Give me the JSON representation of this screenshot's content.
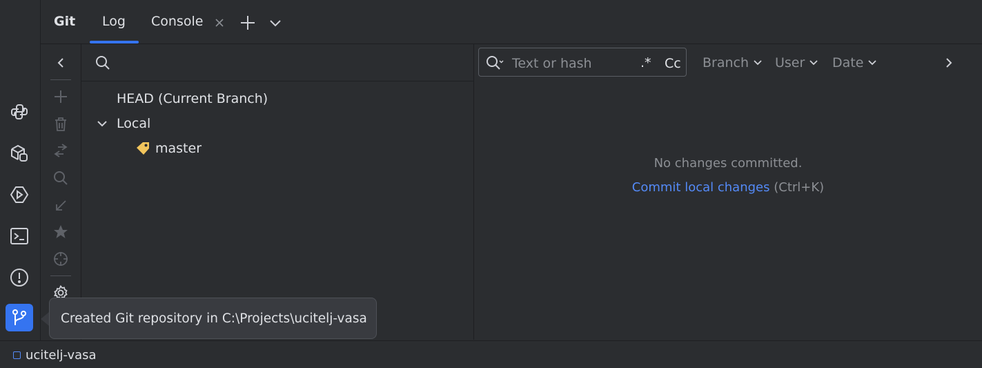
{
  "header": {
    "title": "Git",
    "tabs": [
      {
        "label": "Log",
        "active": true
      },
      {
        "label": "Console",
        "closable": true
      }
    ],
    "add_tab_icon": "plus-icon",
    "more_tabs_icon": "chevron-down-icon"
  },
  "activity_bar": {
    "icons": [
      "python-icon",
      "python-packages-icon",
      "services-icon",
      "terminal-icon",
      "problems-icon",
      "git-branch-icon"
    ],
    "active": "git-branch-icon"
  },
  "branch_toolbar": {
    "icons": [
      "collapse-left-icon",
      "new-branch-icon",
      "delete-icon",
      "compare-icon",
      "search-icon",
      "checkout-icon",
      "favorite-icon",
      "target-icon",
      "settings-icon"
    ]
  },
  "branches": {
    "search_placeholder": "",
    "tree": {
      "head": "HEAD (Current Branch)",
      "local_label": "Local",
      "local_branches": [
        "master"
      ]
    }
  },
  "log": {
    "filter_placeholder": "Text or hash",
    "regex_label": ".*",
    "case_label": "Cc",
    "filters": [
      "Branch",
      "User",
      "Date"
    ],
    "empty_message": "No changes committed.",
    "commit_link": "Commit local changes",
    "commit_shortcut": "(Ctrl+K)"
  },
  "tooltip": {
    "text": "Created Git repository in C:\\Projects\\ucitelj-vasa"
  },
  "status_bar": {
    "project_name": "ucitelj-vasa"
  },
  "colors": {
    "background": "#2b2d30",
    "accent": "#3574f0",
    "link": "#548af7",
    "muted_text": "#8c8f94",
    "branch_tag": "#f2c55c"
  }
}
